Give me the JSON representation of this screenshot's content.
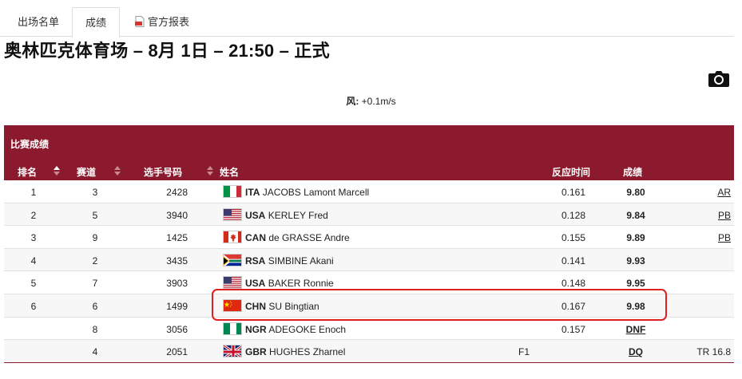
{
  "tabs": {
    "startlist": "出场名单",
    "results": "成绩",
    "official_report": "官方报表"
  },
  "title": "奥林匹克体育场 – 8月 1日 – 21:50 – 正式",
  "wind": {
    "label": "风:",
    "value": "+0.1m/s"
  },
  "panel": {
    "heading": "比赛成绩",
    "columns": {
      "rank": "排名",
      "lane": "赛道",
      "bib": "选手号码",
      "name": "姓名",
      "reaction": "反应时间",
      "result": "成绩"
    }
  },
  "rows": [
    {
      "rank": "1",
      "lane": "3",
      "bib": "2428",
      "country": "ITA",
      "athlete": "JACOBS Lamont Marcell",
      "f1": "",
      "reaction": "0.161",
      "result": "9.80",
      "record": "AR",
      "flag": "ita"
    },
    {
      "rank": "2",
      "lane": "5",
      "bib": "3940",
      "country": "USA",
      "athlete": "KERLEY Fred",
      "f1": "",
      "reaction": "0.128",
      "result": "9.84",
      "record": "PB",
      "flag": "usa"
    },
    {
      "rank": "3",
      "lane": "9",
      "bib": "1425",
      "country": "CAN",
      "athlete": "de GRASSE Andre",
      "f1": "",
      "reaction": "0.155",
      "result": "9.89",
      "record": "PB",
      "flag": "can"
    },
    {
      "rank": "4",
      "lane": "2",
      "bib": "3435",
      "country": "RSA",
      "athlete": "SIMBINE Akani",
      "f1": "",
      "reaction": "0.141",
      "result": "9.93",
      "record": "",
      "flag": "rsa"
    },
    {
      "rank": "5",
      "lane": "7",
      "bib": "3903",
      "country": "USA",
      "athlete": "BAKER Ronnie",
      "f1": "",
      "reaction": "0.148",
      "result": "9.95",
      "record": "",
      "flag": "usa"
    },
    {
      "rank": "6",
      "lane": "6",
      "bib": "1499",
      "country": "CHN",
      "athlete": "SU Bingtian",
      "f1": "",
      "reaction": "0.167",
      "result": "9.98",
      "record": "",
      "flag": "chn"
    },
    {
      "rank": "",
      "lane": "8",
      "bib": "3056",
      "country": "NGR",
      "athlete": "ADEGOKE Enoch",
      "f1": "",
      "reaction": "0.157",
      "result": "DNF",
      "record": "",
      "flag": "ngr"
    },
    {
      "rank": "",
      "lane": "4",
      "bib": "2051",
      "country": "GBR",
      "athlete": "HUGHES Zharnel",
      "f1": "F1",
      "reaction": "",
      "result": "DQ",
      "record": "TR 16.8",
      "flag": "gbr"
    }
  ],
  "colors": {
    "header_bg": "#8c1a2e",
    "highlight_border": "#e0201f"
  }
}
